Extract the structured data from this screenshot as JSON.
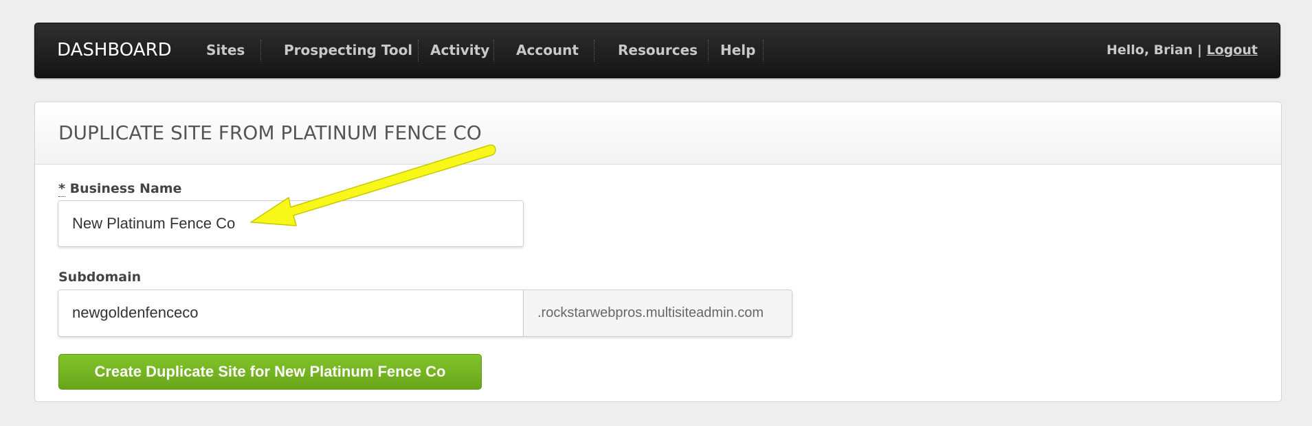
{
  "nav": {
    "brand": "DASHBOARD",
    "items": [
      {
        "label": "Sites"
      },
      {
        "label": "Prospecting Tool"
      },
      {
        "label": "Activity"
      },
      {
        "label": "Account"
      },
      {
        "label": "Resources"
      },
      {
        "label": "Help"
      }
    ],
    "greeting": "Hello, Brian |",
    "logout": "Logout"
  },
  "panel": {
    "title": "DUPLICATE SITE FROM PLATINUM FENCE CO"
  },
  "form": {
    "business_name": {
      "required_mark": "*",
      "label": "Business Name",
      "value": "New Platinum Fence Co"
    },
    "subdomain": {
      "label": "Subdomain",
      "value": "newgoldenfenceco",
      "suffix": ".rockstarwebpros.multisiteadmin.com"
    },
    "submit_label": "Create Duplicate Site for New Platinum Fence Co"
  },
  "annotation": {
    "arrow_color": "#f7f71a",
    "icon": "annotation-arrow-icon"
  },
  "colors": {
    "navbar": "#1c1c1c",
    "button": "#76b82a",
    "background": "#eeeeee"
  }
}
